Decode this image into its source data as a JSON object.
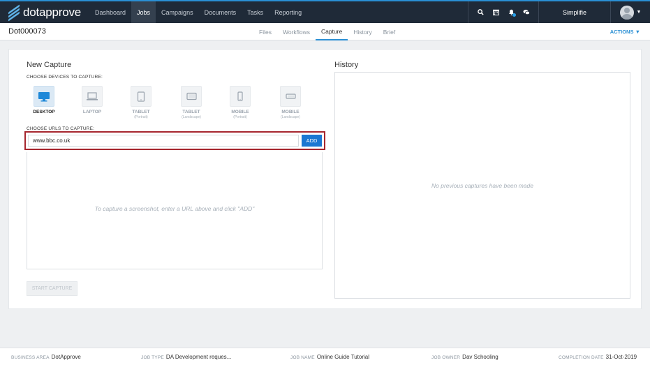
{
  "app": {
    "logo_text": "dotapprove",
    "nav": [
      "Dashboard",
      "Jobs",
      "Campaigns",
      "Documents",
      "Tasks",
      "Reporting"
    ],
    "active_nav": "Jobs",
    "icons": [
      "search-icon",
      "calendar-icon",
      "bell-icon",
      "chat-icon"
    ],
    "org_name": "Simplifie",
    "accent_color": "#2a8fd4",
    "nav_bg_color": "#1f2a38"
  },
  "subheader": {
    "job_id": "Dot000073",
    "tabs": [
      "Files",
      "Workflows",
      "Capture",
      "History",
      "Brief"
    ],
    "active_tab": "Capture",
    "actions_label": "ACTIONS"
  },
  "capture": {
    "title": "New Capture",
    "devices_label": "CHOOSE DEVICES TO CAPTURE:",
    "devices": [
      {
        "name": "DESKTOP",
        "sub": "",
        "icon": "desktop-icon",
        "selected": true
      },
      {
        "name": "LAPTOP",
        "sub": "",
        "icon": "laptop-icon",
        "selected": false
      },
      {
        "name": "TABLET",
        "sub": "(Portrait)",
        "icon": "tablet-portrait-icon",
        "selected": false
      },
      {
        "name": "TABLET",
        "sub": "(Landscape)",
        "icon": "tablet-landscape-icon",
        "selected": false
      },
      {
        "name": "MOBILE",
        "sub": "(Portrait)",
        "icon": "mobile-portrait-icon",
        "selected": false
      },
      {
        "name": "MOBILE",
        "sub": "(Landscape)",
        "icon": "mobile-landscape-icon",
        "selected": false
      }
    ],
    "urls_label": "CHOOSE URLS TO CAPTURE:",
    "url_value": "www.bbc.co.uk",
    "add_label": "ADD",
    "empty_hint": "To capture a screenshot, enter a URL above and click \"ADD\"",
    "start_label": "START CAPTURE"
  },
  "history": {
    "title": "History",
    "empty": "No previous captures have been made"
  },
  "footer": {
    "business_area_label": "BUSINESS AREA",
    "business_area": "DotApprove",
    "job_type_label": "JOB TYPE",
    "job_type": "DA Development reques...",
    "job_name_label": "JOB NAME",
    "job_name": "Online Guide Tutorial",
    "job_owner_label": "JOB OWNER",
    "job_owner": "Dav Schooling",
    "completion_label": "COMPLETION DATE",
    "completion_date": "31-Oct-2019"
  }
}
